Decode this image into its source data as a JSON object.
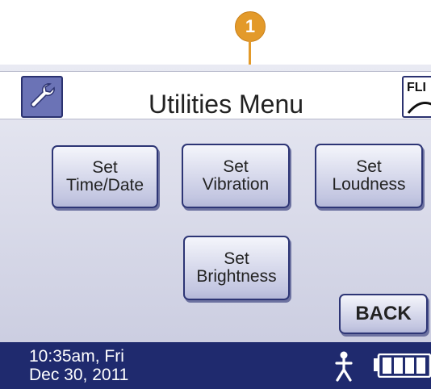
{
  "callout": {
    "number": "1"
  },
  "header": {
    "title": "Utilities Menu",
    "flight_label": "FLI",
    "left_icon": "wrench-icon",
    "right_icon": "flight-mode-icon"
  },
  "buttons": {
    "time_date": "Set\nTime/Date",
    "vibration": "Set\nVibration",
    "loudness": "Set\nLoudness",
    "brightness": "Set\nBrightness",
    "back": "BACK"
  },
  "status": {
    "time": "10:35am, Fri",
    "date": "Dec 30, 2011",
    "icons": [
      "person-icon",
      "battery-icon"
    ]
  },
  "colors": {
    "accent_orange": "#e39a2a",
    "navy": "#1f2a6e",
    "button_border": "#2d3575",
    "icon_button": "#6b73b6"
  }
}
